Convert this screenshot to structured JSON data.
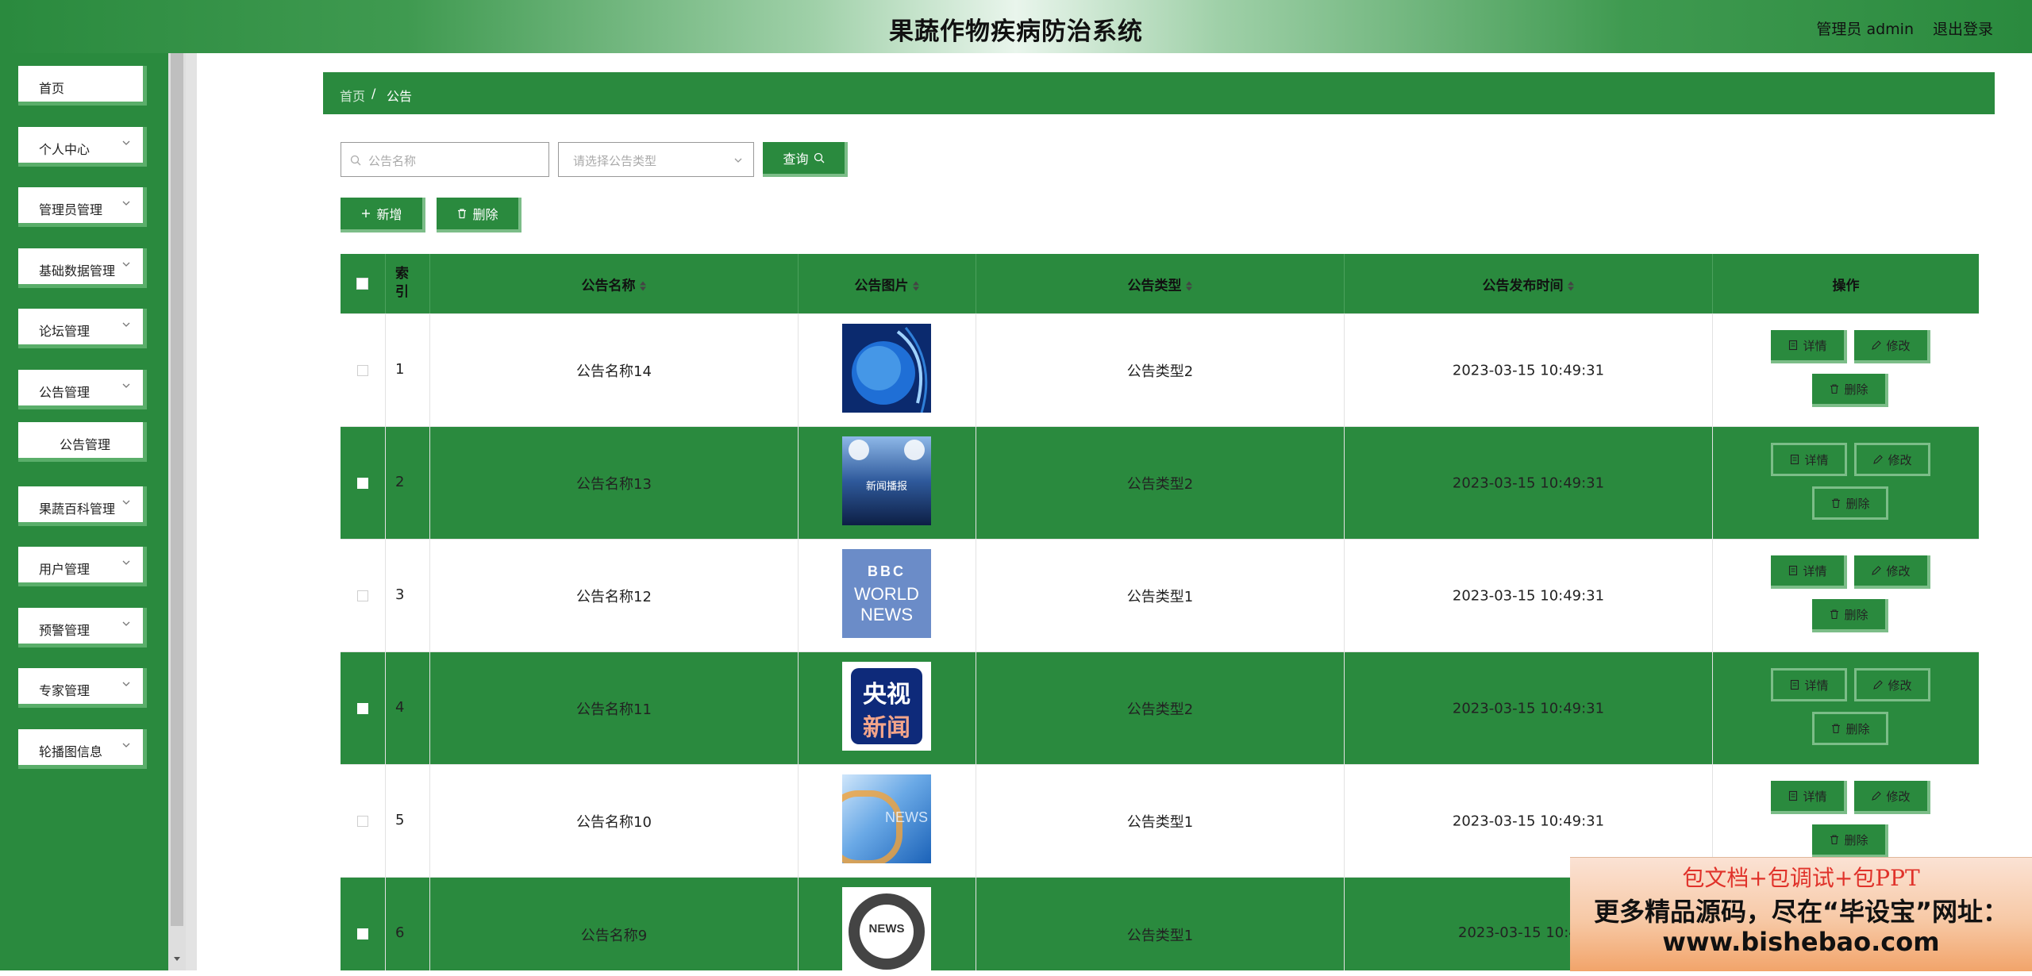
{
  "header": {
    "title": "果蔬作物疾病防治系统",
    "user": "管理员 admin",
    "logout": "退出登录"
  },
  "sidebar": {
    "items": [
      {
        "label": "首页",
        "has_arrow": false
      },
      {
        "label": "个人中心",
        "has_arrow": true
      },
      {
        "label": "管理员管理",
        "has_arrow": true
      },
      {
        "label": "基础数据管理",
        "has_arrow": true
      },
      {
        "label": "论坛管理",
        "has_arrow": true
      },
      {
        "label": "公告管理",
        "has_arrow": true
      },
      {
        "label": "公告管理",
        "has_arrow": false,
        "sub": true
      },
      {
        "label": "果蔬百科管理",
        "has_arrow": true
      },
      {
        "label": "用户管理",
        "has_arrow": true
      },
      {
        "label": "预警管理",
        "has_arrow": true
      },
      {
        "label": "专家管理",
        "has_arrow": true
      },
      {
        "label": "轮播图信息",
        "has_arrow": true
      }
    ]
  },
  "breadcrumb": {
    "home": "首页",
    "sep": "/",
    "current": "公告"
  },
  "filters": {
    "name_placeholder": "公告名称",
    "type_placeholder": "请选择公告类型",
    "query_label": "查询"
  },
  "toolbar": {
    "add_label": "新增",
    "delete_label": "删除"
  },
  "table": {
    "columns": {
      "index": "索引",
      "name": "公告名称",
      "image": "公告图片",
      "type": "公告类型",
      "time": "公告发布时间",
      "actions": "操作"
    },
    "action_labels": {
      "detail": "详情",
      "edit": "修改",
      "delete": "删除"
    },
    "rows": [
      {
        "index": "1",
        "name": "公告名称14",
        "image": "earth-globe-news-image",
        "type": "公告类型2",
        "time": "2023-03-15 10:49:31"
      },
      {
        "index": "2",
        "name": "公告名称13",
        "image": "stage-spotlight-news-image",
        "type": "公告类型2",
        "time": "2023-03-15 10:49:31",
        "image_caption": "新闻播报"
      },
      {
        "index": "3",
        "name": "公告名称12",
        "image": "bbc-world-news-logo",
        "type": "公告类型1",
        "time": "2023-03-15 10:49:31",
        "image_caption": "BBC",
        "image_caption2": "WORLD",
        "image_caption3": "NEWS"
      },
      {
        "index": "4",
        "name": "公告名称11",
        "image": "cctv-news-logo",
        "type": "公告类型2",
        "time": "2023-03-15 10:49:31",
        "image_caption": "央视",
        "image_caption2": "新闻"
      },
      {
        "index": "5",
        "name": "公告名称10",
        "image": "blue-news-abstract-image",
        "type": "公告类型1",
        "time": "2023-03-15 10:49:31",
        "image_caption": "NEWS"
      },
      {
        "index": "6",
        "name": "公告名称9",
        "image": "news-globe-icon-image",
        "type": "公告类型1",
        "time": "2023-03-15 10:4",
        "image_caption": "NEWS"
      }
    ]
  },
  "ad": {
    "line1": "包文档+包调试+包PPT",
    "line2": "更多精品源码，尽在“毕设宝”网址：",
    "line3": "www.bishebao.com"
  },
  "colors": {
    "primary_green": "#2a8a3e",
    "light_green": "#7cbd88",
    "ad_red": "#e0322a"
  }
}
